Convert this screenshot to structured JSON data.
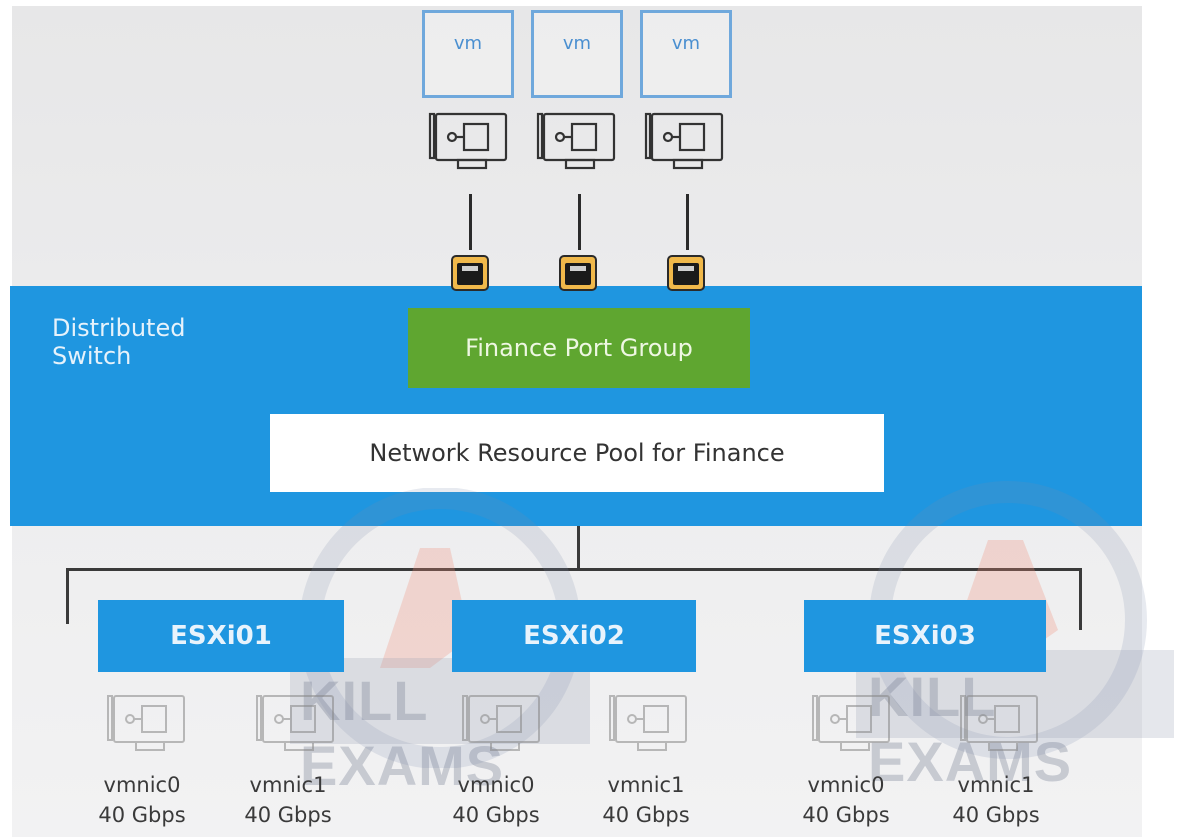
{
  "vms": [
    {
      "label": "vm"
    },
    {
      "label": "vm"
    },
    {
      "label": "vm"
    }
  ],
  "switch": {
    "label_line1": "Distributed",
    "label_line2": "Switch"
  },
  "port_group": {
    "label": "Finance Port Group"
  },
  "resource_pool": {
    "label": "Network Resource Pool for Finance"
  },
  "hosts": [
    {
      "name": "ESXi01",
      "nics": [
        {
          "name": "vmnic0",
          "speed": "40 Gbps"
        },
        {
          "name": "vmnic1",
          "speed": "40 Gbps"
        }
      ]
    },
    {
      "name": "ESXi02",
      "nics": [
        {
          "name": "vmnic0",
          "speed": "40 Gbps"
        },
        {
          "name": "vmnic1",
          "speed": "40 Gbps"
        }
      ]
    },
    {
      "name": "ESXi03",
      "nics": [
        {
          "name": "vmnic0",
          "speed": "40 Gbps"
        },
        {
          "name": "vmnic1",
          "speed": "40 Gbps"
        }
      ]
    }
  ],
  "watermark": {
    "text": "KILL EXAMS"
  },
  "colors": {
    "switch": "#1f96e0",
    "port_group": "#5fa630",
    "vm_border": "#6fa8dc"
  }
}
